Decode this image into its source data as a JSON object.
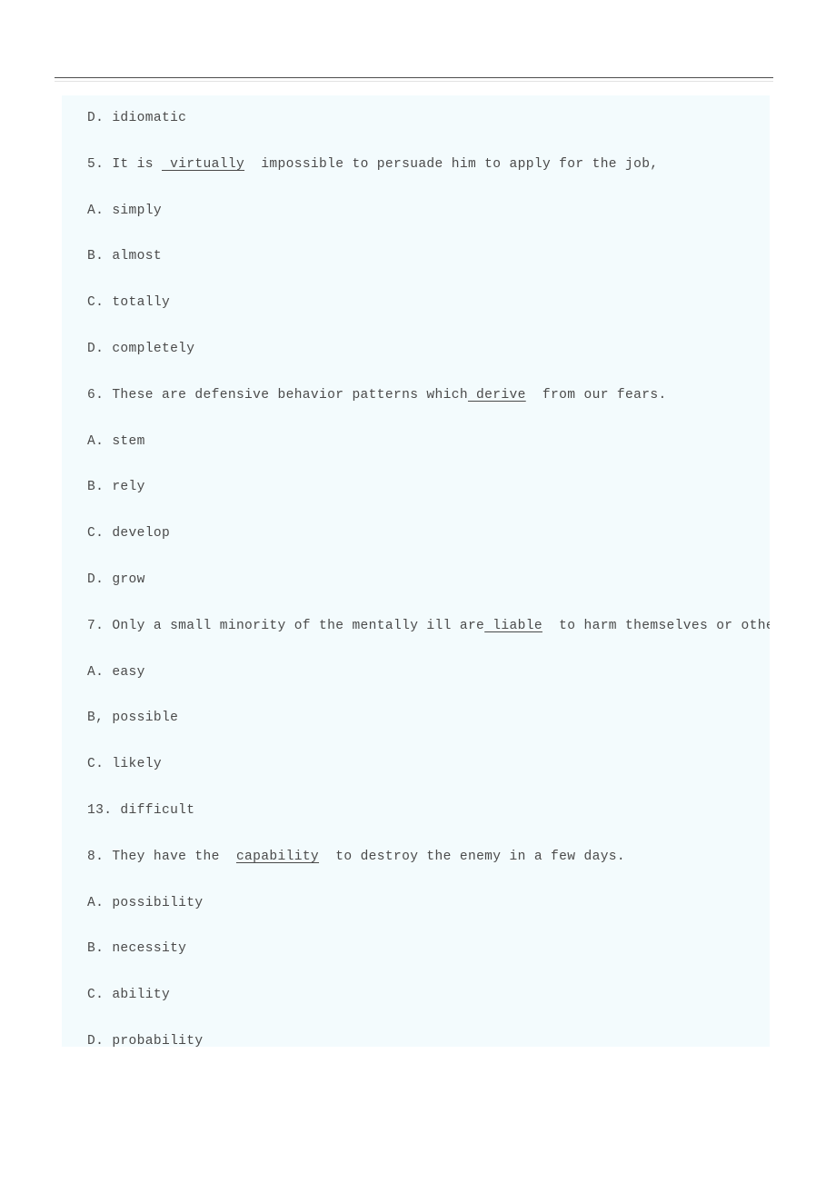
{
  "page": {
    "background_color": "#ffffff",
    "content_block_color": "#f3fbfd",
    "text_color": "#4a4a4a",
    "rule_color": "#4d4d4d"
  },
  "header": {
    "rule_label": "horizontal-rule"
  },
  "document": {
    "lines": [
      {
        "id": "l01",
        "kind": "option",
        "text": "D. idiomatic"
      },
      {
        "id": "l02",
        "kind": "question",
        "prefix": "5. It is ",
        "underlined": " virtually",
        "suffix": "  impossible to persuade him to apply for the job,"
      },
      {
        "id": "l03",
        "kind": "option",
        "text": "A. simply"
      },
      {
        "id": "l04",
        "kind": "option",
        "text": "B. almost"
      },
      {
        "id": "l05",
        "kind": "option",
        "text": "C. totally"
      },
      {
        "id": "l06",
        "kind": "option",
        "text": "D. completely"
      },
      {
        "id": "l07",
        "kind": "question",
        "prefix": "6. These are defensive behavior patterns which",
        "underlined": " derive",
        "suffix": "  from our fears."
      },
      {
        "id": "l08",
        "kind": "option",
        "text": "A. stem"
      },
      {
        "id": "l09",
        "kind": "option",
        "text": "B. rely"
      },
      {
        "id": "l10",
        "kind": "option",
        "text": "C. develop"
      },
      {
        "id": "l11",
        "kind": "option",
        "text": "D. grow"
      },
      {
        "id": "l12",
        "kind": "question",
        "prefix": "7. Only a small minority of the mentally ill are",
        "underlined": " liable",
        "suffix": "  to harm themselves or others,"
      },
      {
        "id": "l13",
        "kind": "option",
        "text": "A. easy"
      },
      {
        "id": "l14",
        "kind": "option",
        "text": "B, possible"
      },
      {
        "id": "l15",
        "kind": "option",
        "text": "C. likely"
      },
      {
        "id": "l16",
        "kind": "option",
        "text": "13. difficult"
      },
      {
        "id": "l17",
        "kind": "question",
        "prefix": "8. They have the  ",
        "underlined": "capability",
        "suffix": "  to destroy the enemy in a few days."
      },
      {
        "id": "l18",
        "kind": "option",
        "text": "A. possibility"
      },
      {
        "id": "l19",
        "kind": "option",
        "text": "B. necessity"
      },
      {
        "id": "l20",
        "kind": "option",
        "text": "C. ability"
      },
      {
        "id": "l21",
        "kind": "option",
        "text": "D. probability"
      }
    ]
  }
}
